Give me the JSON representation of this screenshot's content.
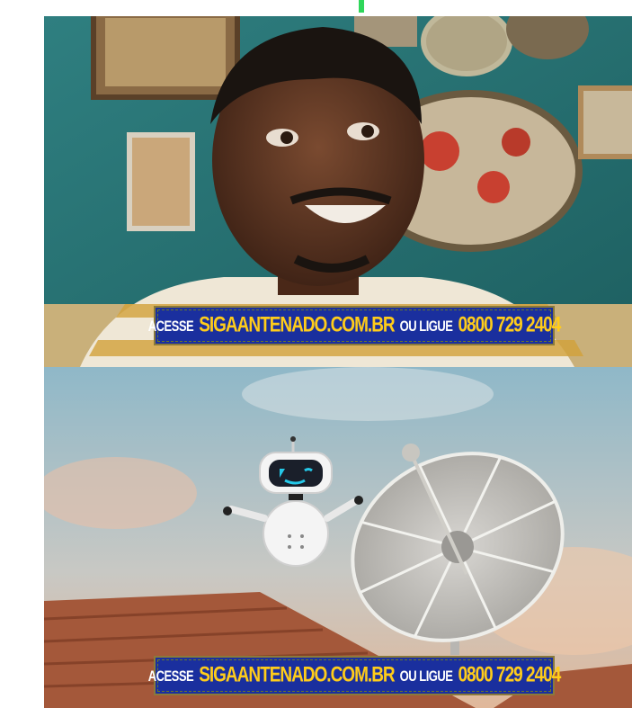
{
  "banner_top": {
    "prefix": "ACESSE",
    "site": "SIGAANTENADO.COM.BR",
    "middle": "OU LIGUE",
    "phone": "0800 729 2404"
  },
  "banner_bottom": {
    "prefix": "ACESSE",
    "site": "SIGAANTENADO.COM.BR",
    "middle": "OU LIGUE",
    "phone": "0800 729 2404"
  },
  "colors": {
    "banner_bg": "#1a2f9e",
    "banner_accent": "#ffcc1a",
    "marker": "#2fd65a"
  }
}
